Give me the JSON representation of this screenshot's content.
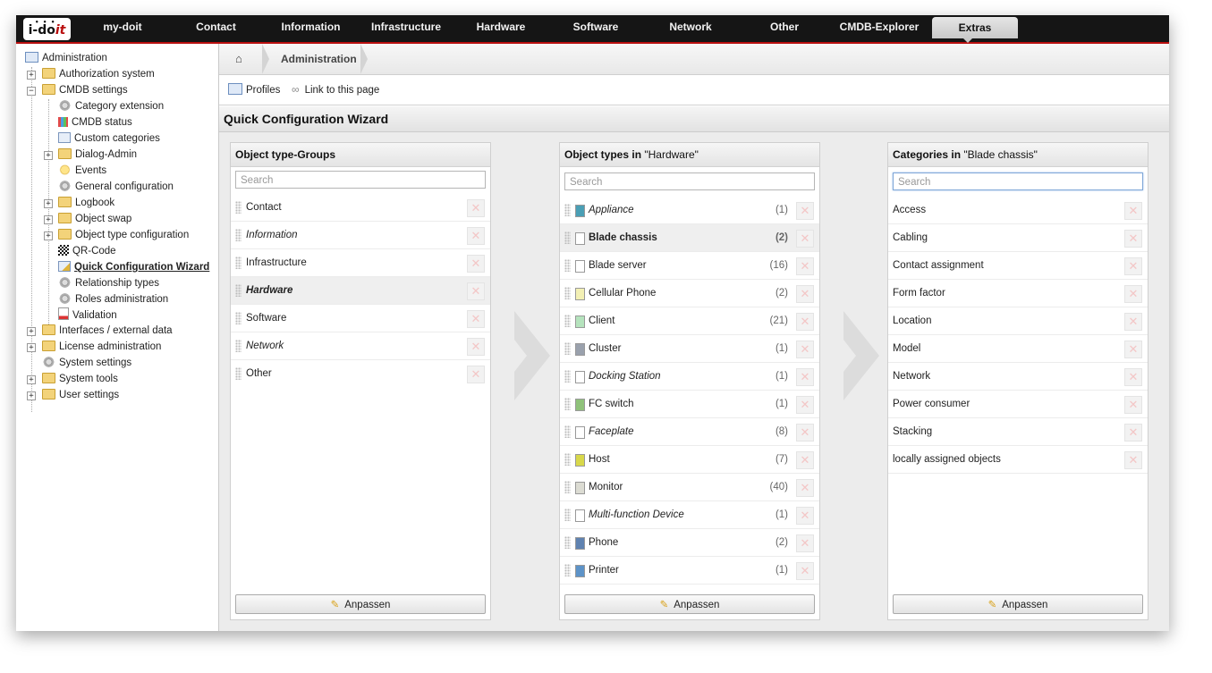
{
  "logo": {
    "text_a": "i-do",
    "text_b": "it"
  },
  "nav": {
    "items": [
      "my-doit",
      "Contact",
      "Information",
      "Infrastructure",
      "Hardware",
      "Software",
      "Network",
      "Other",
      "CMDB-Explorer",
      "Extras"
    ],
    "active": "Extras"
  },
  "sidebar": {
    "root": "Administration",
    "items": [
      {
        "label": "Authorization system"
      },
      {
        "label": "CMDB settings"
      },
      {
        "label": "Category extension"
      },
      {
        "label": "CMDB status"
      },
      {
        "label": "Custom categories"
      },
      {
        "label": "Dialog-Admin"
      },
      {
        "label": "Events"
      },
      {
        "label": "General configuration"
      },
      {
        "label": "Logbook"
      },
      {
        "label": "Object swap"
      },
      {
        "label": "Object type configuration"
      },
      {
        "label": "QR-Code"
      },
      {
        "label": "Quick Configuration Wizard"
      },
      {
        "label": "Relationship types"
      },
      {
        "label": "Roles administration"
      },
      {
        "label": "Validation"
      },
      {
        "label": "Interfaces / external data"
      },
      {
        "label": "License administration"
      },
      {
        "label": "System settings"
      },
      {
        "label": "System tools"
      },
      {
        "label": "User settings"
      }
    ]
  },
  "breadcrumb": {
    "current": "Administration"
  },
  "toolbar": {
    "profiles": "Profiles",
    "link": "Link to this page"
  },
  "page_title": "Quick Configuration Wizard",
  "panels": {
    "groups": {
      "title": "Object type-Groups",
      "search_placeholder": "Search",
      "items": [
        "Contact",
        "Information",
        "Infrastructure",
        "Hardware",
        "Software",
        "Network",
        "Other"
      ],
      "button": "Anpassen"
    },
    "types": {
      "title_prefix": "Object types in ",
      "title_value": "\"Hardware\"",
      "search_placeholder": "Search",
      "items": [
        {
          "label": "Appliance",
          "count": "(1)",
          "color": "#4a9fb5"
        },
        {
          "label": "Blade chassis",
          "count": "(2)",
          "color": "#ffffff"
        },
        {
          "label": "Blade server",
          "count": "(16)",
          "color": "#ffffff"
        },
        {
          "label": "Cellular Phone",
          "count": "(2)",
          "color": "#f3f0b4"
        },
        {
          "label": "Client",
          "count": "(21)",
          "color": "#b5e3bd"
        },
        {
          "label": "Cluster",
          "count": "(1)",
          "color": "#9aa1ad"
        },
        {
          "label": "Docking Station",
          "count": "(1)",
          "color": "#ffffff"
        },
        {
          "label": "FC switch",
          "count": "(1)",
          "color": "#8fc27a"
        },
        {
          "label": "Faceplate",
          "count": "(8)",
          "color": "#ffffff"
        },
        {
          "label": "Host",
          "count": "(7)",
          "color": "#d8d84a"
        },
        {
          "label": "Monitor",
          "count": "(40)",
          "color": "#dcdcd3"
        },
        {
          "label": "Multi-function Device",
          "count": "(1)",
          "color": "#ffffff"
        },
        {
          "label": "Phone",
          "count": "(2)",
          "color": "#5f82b0"
        },
        {
          "label": "Printer",
          "count": "(1)",
          "color": "#5d93c8"
        }
      ],
      "button": "Anpassen"
    },
    "categories": {
      "title_prefix": "Categories in ",
      "title_value": "\"Blade chassis\"",
      "search_placeholder": "Search",
      "items": [
        "Access",
        "Cabling",
        "Contact assignment",
        "Form factor",
        "Location",
        "Model",
        "Network",
        "Power consumer",
        "Stacking",
        "locally assigned objects"
      ],
      "button": "Anpassen"
    }
  }
}
